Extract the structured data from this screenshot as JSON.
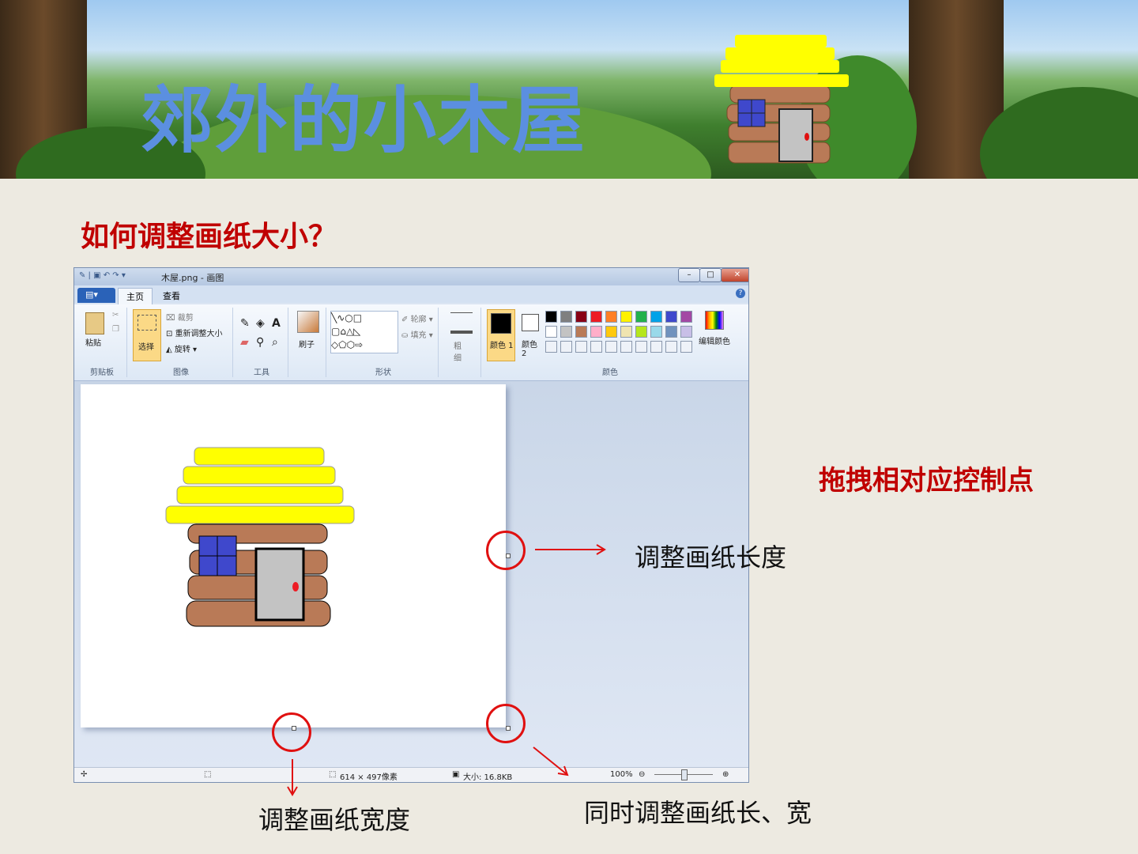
{
  "banner": {
    "title": "郊外的小木屋"
  },
  "heading": "如何调整画纸大小？",
  "window": {
    "title": "木屋.png - 画图",
    "tabs": {
      "home": "主页",
      "view": "查看"
    },
    "ribbon": {
      "clipboard": {
        "paste": "粘贴",
        "label": "剪贴板"
      },
      "image": {
        "select": "选择",
        "crop": "裁剪",
        "resize": "重新调整大小",
        "rotate": "旋转",
        "label": "图像"
      },
      "tools": {
        "label": "工具"
      },
      "brushes": {
        "label": "刷子"
      },
      "shapes": {
        "outline": "轮廓",
        "fill": "填充",
        "label": "形状"
      },
      "size": {
        "label": "粗细"
      },
      "colors": {
        "color1": "颜色 1",
        "color2": "颜色 2",
        "edit": "编辑颜色",
        "label": "颜色",
        "palette": [
          "#000000",
          "#7f7f7f",
          "#880015",
          "#ed1c24",
          "#ff7f27",
          "#fff200",
          "#22b14c",
          "#00a2e8",
          "#3f48cc",
          "#a349a4",
          "#ffffff",
          "#c3c3c3",
          "#b97a57",
          "#ffaec9",
          "#ffc90e",
          "#efe4b0",
          "#b5e61d",
          "#99d9ea",
          "#7092be",
          "#c8bfe7"
        ]
      }
    },
    "status": {
      "dimensions": "614 × 497像素",
      "size": "大小: 16.8KB",
      "zoom": "100%"
    }
  },
  "annotations": {
    "drag_hint": "拖拽相对应控制点",
    "length": "调整画纸长度",
    "width": "调整画纸宽度",
    "both": "同时调整画纸长、宽"
  },
  "colors": {
    "accent_red": "#c00000",
    "title_blue": "#5b8fe0",
    "roof": "#ffff00",
    "wall": "#b97a57",
    "window": "#3f48cc",
    "door": "#c3c3c3"
  }
}
